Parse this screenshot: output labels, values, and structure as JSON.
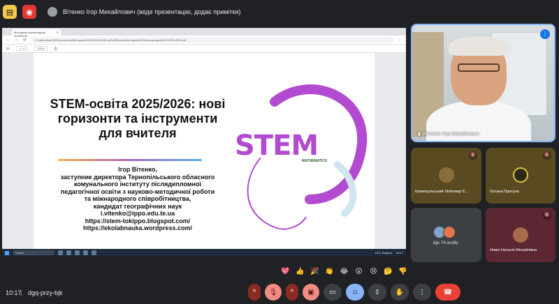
{
  "topbar": {
    "presenter_label": "Вітенко Ігор Михайлович (веде презентацію, додає примітки)"
  },
  "browser": {
    "tab_title": "Методичні рекомендації 2025/2026",
    "url": "C:/Users/ihor/%20Documents/Методичні%202025/2026/Ігор%20Вітенко/Методичні%20рекомендації%202025-2026.pdf",
    "pdf_zoom": "100%",
    "page_indicator": "1 / 4"
  },
  "slide": {
    "title": "STEM-освіта 2025/2026: нові горизонти та інструменти для вчителя",
    "logo_word": "STEM",
    "logo_sub": "MATHEMATICS",
    "author": "Ігор Вітенко,",
    "lines": [
      "заступник директора Тернопільського обласного",
      "комунального інституту післядипломної",
      "педагогічної освіти з науково-методичної роботи",
      "та міжнародного співробітництва,",
      "кандидат географічних наук",
      "i.vitenko@ippo.edu.te.ua",
      "https://stem-tokippo.blogspot.com/",
      "https://ekolabnauka.wordpress.com/"
    ]
  },
  "taskbar": {
    "search_placeholder": "Пошук",
    "weather": "15°C Хмарно",
    "clock": "10:17"
  },
  "participants": {
    "main_name": "Вітенко Ігор Михайлович",
    "tile_a": "Кривокульський Любомир Є...",
    "tile_b": "Оксана Притула",
    "tile_c_more": "Ще 74 особи",
    "tile_d": "Ніжко Наталія Михайлівна"
  },
  "reactions": [
    "💖",
    "👍",
    "🎉",
    "👏",
    "😂",
    "😮",
    "😢",
    "🤔",
    "👎"
  ],
  "bottom": {
    "time": "10:17",
    "separator": "|",
    "meeting_code": "dgq-przy-bjk"
  },
  "colors": {
    "meet_bg": "#202124",
    "accent_blue": "#8ab4f8",
    "hangup_red": "#ea4335"
  }
}
